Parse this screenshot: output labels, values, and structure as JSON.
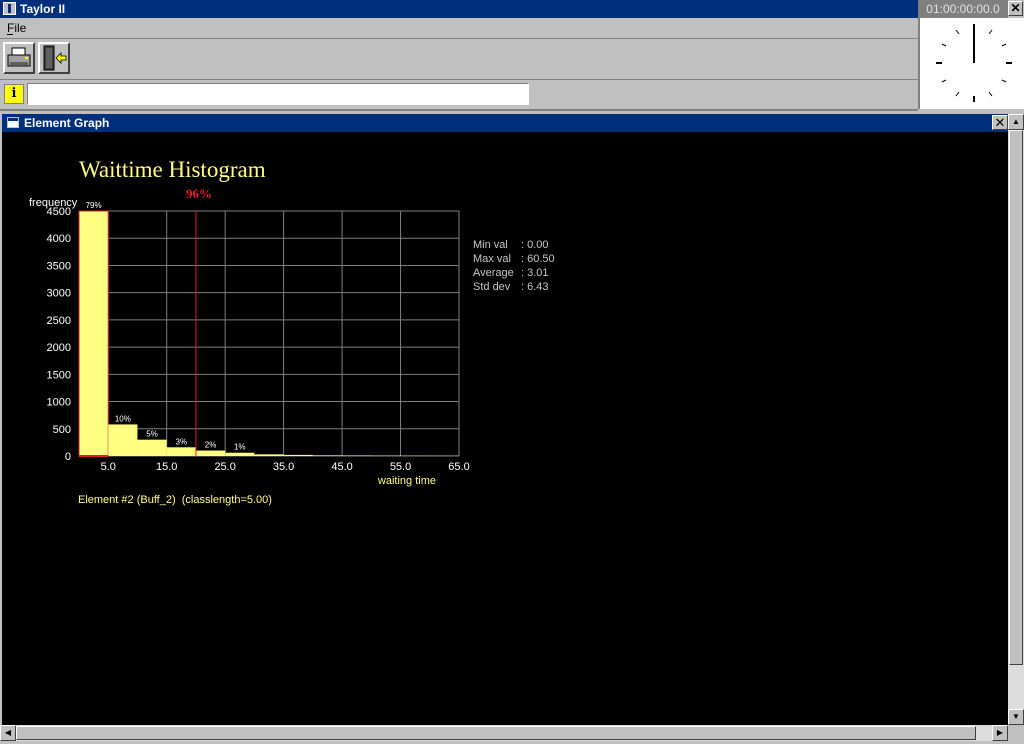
{
  "app": {
    "title": "Taylor II",
    "menu": [
      "File"
    ],
    "clock_time": "01:00:00:00.0",
    "close_glyph": "✕"
  },
  "toolbar": {
    "print_icon": "printer-icon",
    "exit_icon": "exit-door-icon"
  },
  "infobar": {
    "icon": "i",
    "value": ""
  },
  "window": {
    "title": "Element Graph",
    "close_glyph": "✕"
  },
  "chart_data": {
    "type": "bar",
    "title": "Waittime Histogram",
    "ylabel": "frequency",
    "xlabel": "waiting time",
    "ylim": [
      0,
      4500
    ],
    "yticks": [
      0,
      500,
      1000,
      1500,
      2000,
      2500,
      3000,
      3500,
      4000,
      4500
    ],
    "xlim": [
      0,
      65
    ],
    "xticks": [
      "5.0",
      "15.0",
      "25.0",
      "35.0",
      "45.0",
      "55.0",
      "65.0"
    ],
    "class_width": 5,
    "values": [
      4500,
      580,
      300,
      160,
      100,
      60,
      30,
      20,
      12,
      10,
      8,
      6,
      5
    ],
    "bar_labels": [
      "79%",
      "10%",
      "5%",
      "3%",
      "2%",
      "1%"
    ],
    "percentile_line": {
      "label": "96%",
      "x": 20
    },
    "grid": true,
    "colors": {
      "bar": "#ffff80",
      "line": "#e02020",
      "grid": "#808080",
      "text": "#ffffff"
    }
  },
  "stats": [
    {
      "label": "Min val",
      "value": ": 0.00"
    },
    {
      "label": "Max val",
      "value": ": 60.50"
    },
    {
      "label": "Average",
      "value": ": 3.01"
    },
    {
      "label": "Std dev",
      "value": ": 6.43"
    }
  ],
  "element_label": "Element #2 (Buff_2)  (classlength=5.00)"
}
